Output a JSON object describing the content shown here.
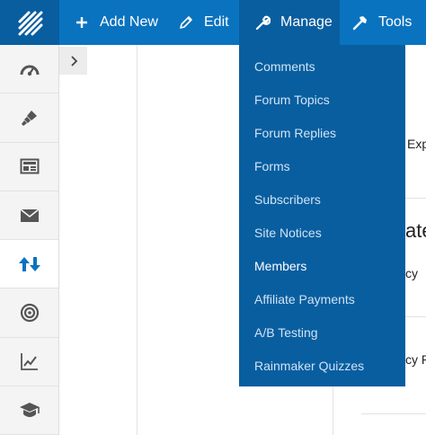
{
  "toolbar": {
    "add_new_label": "Add New",
    "edit_label": "Edit",
    "manage_label": "Manage",
    "tools_label": "Tools"
  },
  "manage_menu": {
    "items": [
      {
        "label": "Comments"
      },
      {
        "label": "Forum Topics"
      },
      {
        "label": "Forum Replies"
      },
      {
        "label": "Forms"
      },
      {
        "label": "Subscribers"
      },
      {
        "label": "Site Notices"
      },
      {
        "label": "Members",
        "current": true
      },
      {
        "label": "Affiliate Payments"
      },
      {
        "label": "A/B Testing"
      },
      {
        "label": "Rainmaker Quizzes"
      }
    ]
  },
  "sidebar": {
    "icons": [
      "dashboard-icon",
      "paintbrush-icon",
      "layout-icon",
      "mail-icon",
      "up-down-arrows-icon",
      "target-icon",
      "line-chart-icon",
      "graduation-cap-icon"
    ],
    "active_index": 4
  },
  "peek": {
    "text1": "Exp",
    "text2": "ate",
    "text3": "cy",
    "text4": "cy P"
  },
  "colors": {
    "topbar": "#0a73bf",
    "topbar_dark": "#095e9f",
    "sidebar_bg": "#f4f4f4",
    "active_icon": "#0a73bf"
  }
}
